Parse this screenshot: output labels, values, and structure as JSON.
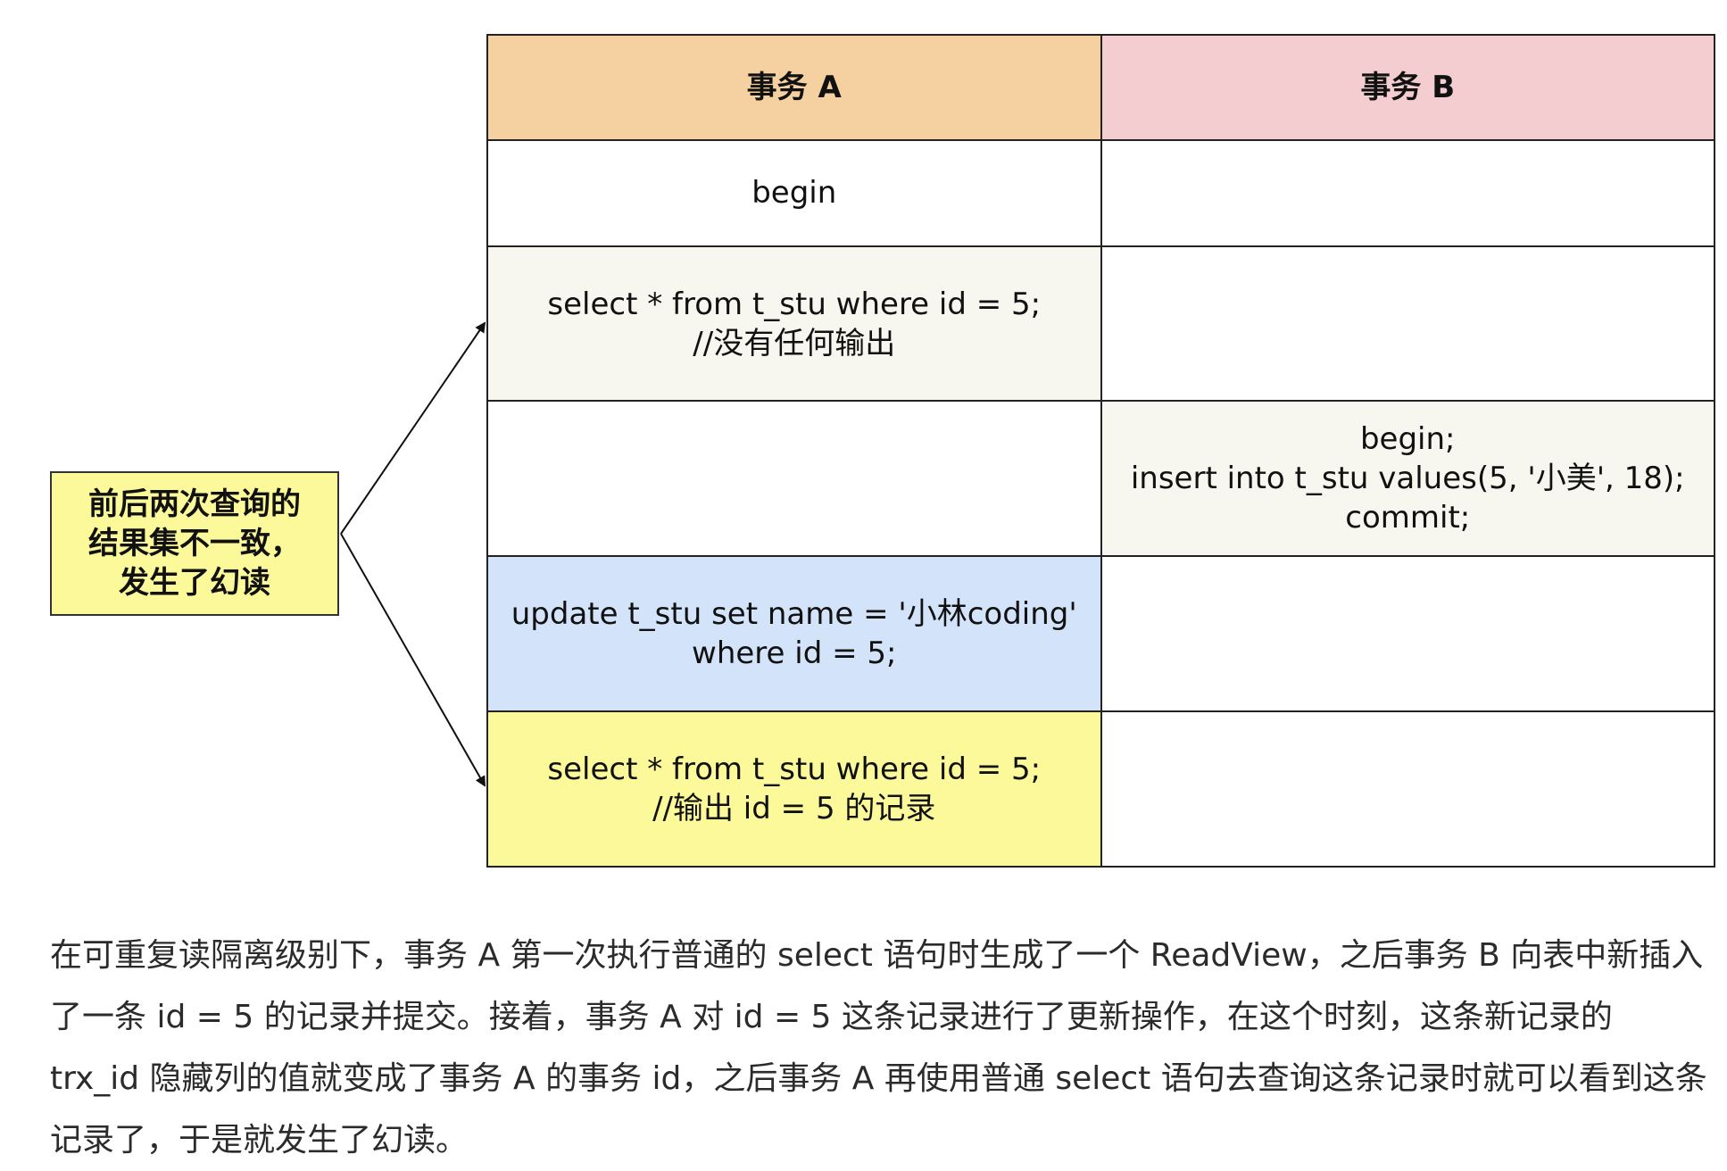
{
  "table": {
    "header_a": "事务 A",
    "header_b": "事务 B",
    "rows": [
      {
        "a_lines": [
          "begin"
        ],
        "b_lines": []
      },
      {
        "a_lines": [
          "select * from t_stu where id = 5;",
          "//没有任何输出"
        ],
        "b_lines": []
      },
      {
        "a_lines": [],
        "b_lines": [
          "begin;",
          "insert into t_stu values(5, '小美', 18);",
          "commit;"
        ]
      },
      {
        "a_lines": [
          "update t_stu set name = '小林coding'",
          "where id = 5;"
        ],
        "b_lines": []
      },
      {
        "a_lines": [
          "select * from t_stu where id = 5;",
          "//输出 id = 5 的记录"
        ],
        "b_lines": []
      }
    ]
  },
  "note": {
    "lines": [
      "前后两次查询的",
      "结果集不一致，",
      "发生了幻读"
    ]
  },
  "caption": "在可重复读隔离级别下，事务 A 第一次执行普通的 select 语句时生成了一个 ReadView，之后事务 B 向表中新插入了一条 id = 5 的记录并提交。接着，事务 A 对 id = 5 这条记录进行了更新操作，在这个时刻，这条新记录的 trx_id 隐藏列的值就变成了事务 A 的事务 id，之后事务 A 再使用普通 select 语句去查询这条记录时就可以看到这条记录了，于是就发生了幻读。",
  "colors": {
    "header_a": "#f5d0a0",
    "header_b": "#f3cdd0",
    "cell_cream": "#f7f7ef",
    "cell_blue": "#d3e4fa",
    "cell_yellow": "#fbf99a",
    "note_bg": "#fbf99a"
  }
}
